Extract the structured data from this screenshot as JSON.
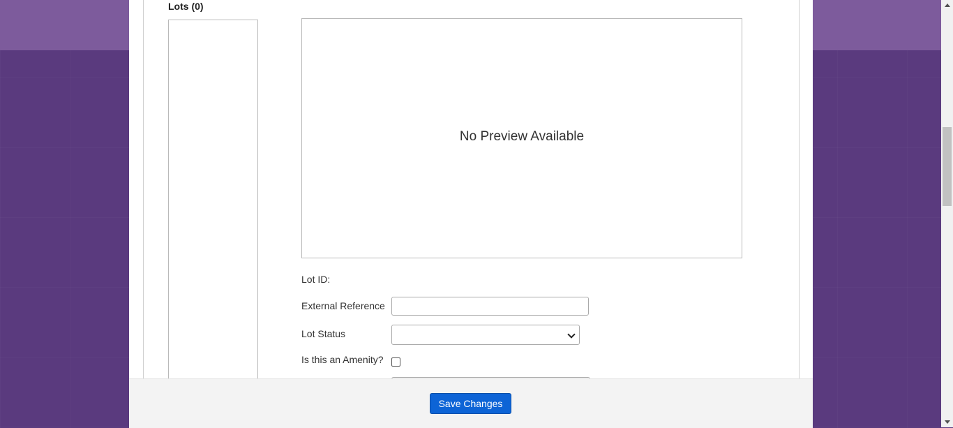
{
  "lots": {
    "heading": "Lots (0)",
    "items": []
  },
  "preview": {
    "message": "No Preview Available"
  },
  "form": {
    "lot_id_label": "Lot ID:",
    "lot_id_value": "",
    "external_reference_label": "External Reference",
    "external_reference_value": "",
    "lot_status_label": "Lot Status",
    "lot_status_selected": "",
    "amenity_label": "Is this an Amenity?",
    "amenity_checked": false
  },
  "footer": {
    "save_label": "Save Changes",
    "save_color": "#0d64d6"
  },
  "theme": {
    "background": "#5a3a7e",
    "top_band": "#7d5b9c"
  },
  "icons": {
    "select_arrow": "chevron-down-icon",
    "scroll_up": "scroll-up-arrow-icon",
    "scroll_down": "scroll-down-arrow-icon"
  }
}
